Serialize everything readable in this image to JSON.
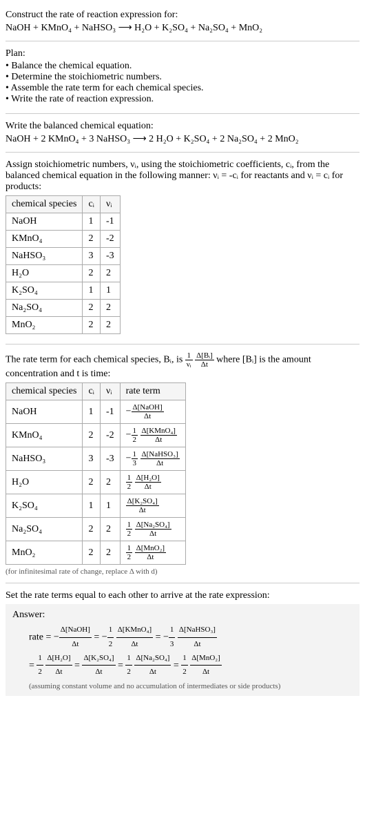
{
  "title": "Construct the rate of reaction expression for:",
  "equation_unbalanced": "NaOH + KMnO₄ + NaHSO₃ ⟶ H₂O + K₂SO₄ + Na₂SO₄ + MnO₂",
  "plan_label": "Plan:",
  "plan": [
    "Balance the chemical equation.",
    "Determine the stoichiometric numbers.",
    "Assemble the rate term for each chemical species.",
    "Write the rate of reaction expression."
  ],
  "balanced_label": "Write the balanced chemical equation:",
  "equation_balanced": "NaOH + 2 KMnO₄ + 3 NaHSO₃ ⟶ 2 H₂O + K₂SO₄ + 2 Na₂SO₄ + 2 MnO₂",
  "assign_text_1": "Assign stoichiometric numbers, νᵢ, using the stoichiometric coefficients, cᵢ, from the balanced chemical equation in the following manner: νᵢ = -cᵢ for reactants and νᵢ = cᵢ for products:",
  "table1": {
    "headers": [
      "chemical species",
      "cᵢ",
      "νᵢ"
    ],
    "rows": [
      [
        "NaOH",
        "1",
        "-1"
      ],
      [
        "KMnO₄",
        "2",
        "-2"
      ],
      [
        "NaHSO₃",
        "3",
        "-3"
      ],
      [
        "H₂O",
        "2",
        "2"
      ],
      [
        "K₂SO₄",
        "1",
        "1"
      ],
      [
        "Na₂SO₄",
        "2",
        "2"
      ],
      [
        "MnO₂",
        "2",
        "2"
      ]
    ]
  },
  "rate_term_text_1": "The rate term for each chemical species, Bᵢ, is",
  "rate_term_text_2": "where [Bᵢ] is the amount concentration and t is time:",
  "table2": {
    "headers": [
      "chemical species",
      "cᵢ",
      "νᵢ",
      "rate term"
    ],
    "rows": [
      {
        "species": "NaOH",
        "c": "1",
        "v": "-1",
        "neg": true,
        "coef": "",
        "num": "Δ[NaOH]",
        "den": "Δt"
      },
      {
        "species": "KMnO₄",
        "c": "2",
        "v": "-2",
        "neg": true,
        "coef": "½",
        "num": "Δ[KMnO₄]",
        "den": "Δt"
      },
      {
        "species": "NaHSO₃",
        "c": "3",
        "v": "-3",
        "neg": true,
        "coef": "⅓",
        "num": "Δ[NaHSO₃]",
        "den": "Δt"
      },
      {
        "species": "H₂O",
        "c": "2",
        "v": "2",
        "neg": false,
        "coef": "½",
        "num": "Δ[H₂O]",
        "den": "Δt"
      },
      {
        "species": "K₂SO₄",
        "c": "1",
        "v": "1",
        "neg": false,
        "coef": "",
        "num": "Δ[K₂SO₄]",
        "den": "Δt"
      },
      {
        "species": "Na₂SO₄",
        "c": "2",
        "v": "2",
        "neg": false,
        "coef": "½",
        "num": "Δ[Na₂SO₄]",
        "den": "Δt"
      },
      {
        "species": "MnO₂",
        "c": "2",
        "v": "2",
        "neg": false,
        "coef": "½",
        "num": "Δ[MnO₂]",
        "den": "Δt"
      }
    ]
  },
  "infinitesimal_note": "(for infinitesimal rate of change, replace Δ with d)",
  "set_equal_text": "Set the rate terms equal to each other to arrive at the rate expression:",
  "answer_label": "Answer:",
  "answer_rate_prefix": "rate = ",
  "answer_assumption": "(assuming constant volume and no accumulation of intermediates or side products)",
  "chart_data": {
    "type": "table",
    "title": "Stoichiometric numbers and rate terms",
    "tables": [
      {
        "name": "stoichiometric numbers",
        "columns": [
          "chemical species",
          "c_i",
          "nu_i"
        ],
        "rows": [
          [
            "NaOH",
            1,
            -1
          ],
          [
            "KMnO4",
            2,
            -2
          ],
          [
            "NaHSO3",
            3,
            -3
          ],
          [
            "H2O",
            2,
            2
          ],
          [
            "K2SO4",
            1,
            1
          ],
          [
            "Na2SO4",
            2,
            2
          ],
          [
            "MnO2",
            2,
            2
          ]
        ]
      }
    ]
  }
}
